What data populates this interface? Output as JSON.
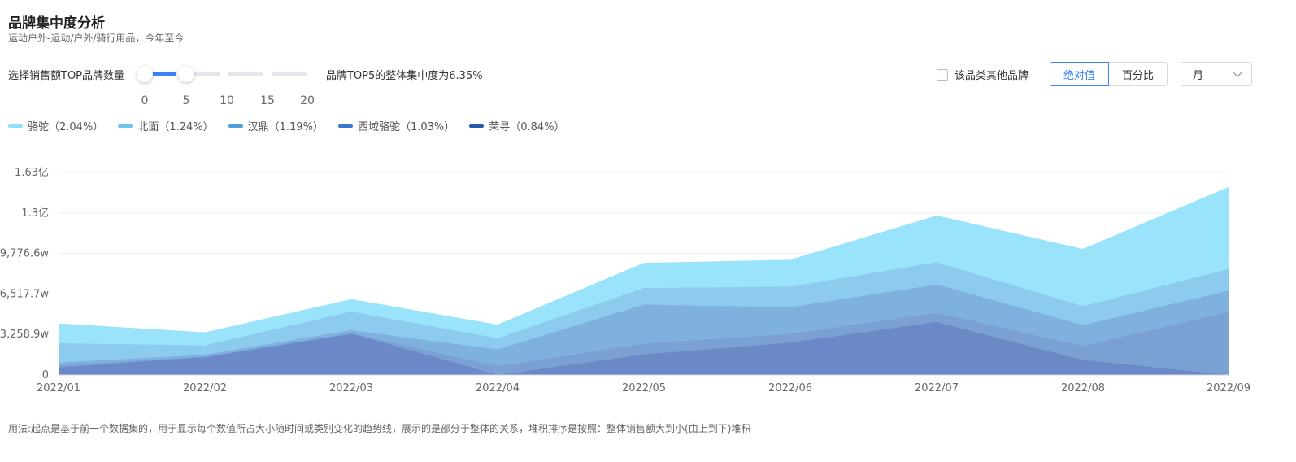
{
  "header": {
    "title": "品牌集中度分析",
    "subtitle": "运动户外-运动/户外/骑行用品，今年至今"
  },
  "controls": {
    "slider_label": "选择销售额TOP品牌数量",
    "slider_ticks": [
      "0",
      "5",
      "10",
      "15",
      "20"
    ],
    "slider_range": [
      0,
      5
    ],
    "concentration_text": "品牌TOP5的整体集中度为6.35%",
    "other_brands_label": "该品类其他品牌",
    "other_brands_checked": false,
    "mode_buttons": [
      "绝对值",
      "百分比"
    ],
    "mode_selected": "绝对值",
    "period_select": "月"
  },
  "legend": [
    {
      "label": "骆驼（2.04%）",
      "color": "#8fe0fa"
    },
    {
      "label": "北面（1.24%）",
      "color": "#6cc6ee"
    },
    {
      "label": "汉鼎（1.19%）",
      "color": "#4f9fdc"
    },
    {
      "label": "西域骆驼（1.03%）",
      "color": "#3a78c8"
    },
    {
      "label": "茉寻（0.84%）",
      "color": "#2a58a8"
    }
  ],
  "chart_data": {
    "type": "area",
    "stacked": true,
    "x": [
      "2022/01",
      "2022/02",
      "2022/03",
      "2022/04",
      "2022/05",
      "2022/06",
      "2022/07",
      "2022/08",
      "2022/09"
    ],
    "y_ticks": [
      "0",
      "3,258.9w",
      "6,517.7w",
      "9,776.6w",
      "1.3亿",
      "1.63亿"
    ],
    "ylim": [
      0,
      16294
    ],
    "y_unit": "w",
    "grid": true,
    "series": [
      {
        "name": "茉寻",
        "color": "#6b89c6",
        "values": [
          600,
          1450,
          3350,
          0,
          1650,
          2600,
          4260,
          1200,
          0
        ]
      },
      {
        "name": "西域骆驼",
        "color": "#7aa0d4",
        "values": [
          150,
          20,
          0,
          700,
          870,
          700,
          740,
          1120,
          5100
        ]
      },
      {
        "name": "汉鼎",
        "color": "#7fb1de",
        "values": [
          250,
          160,
          250,
          1350,
          3140,
          2150,
          2280,
          1690,
          1700
        ]
      },
      {
        "name": "北面",
        "color": "#8ccbed",
        "values": [
          1550,
          750,
          1500,
          900,
          1340,
          1650,
          1780,
          1520,
          1750
        ]
      },
      {
        "name": "骆驼",
        "color": "#99e3fb",
        "values": [
          1550,
          1000,
          950,
          1050,
          1970,
          2120,
          3720,
          4560,
          6550
        ]
      }
    ]
  },
  "footnote": "用法:起点是基于前一个数据集的，用于显示每个数值所占大小随时间或类别变化的趋势线，展示的是部分于整体的关系，堆积排序是按照：整体销售额大到小(由上到下)堆积"
}
